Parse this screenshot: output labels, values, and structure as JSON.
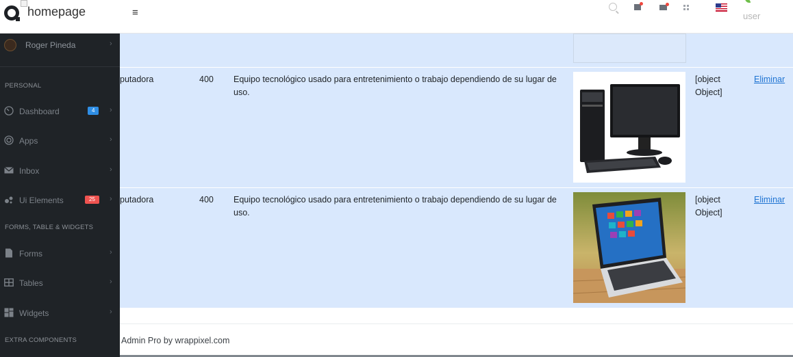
{
  "header": {
    "brand_alt": "homepage",
    "menu_icon": "≡",
    "icons": [
      "search-icon",
      "message-icon",
      "mail-icon",
      "apps-grid-icon",
      "flag-us-icon"
    ],
    "user_alt": "user"
  },
  "sidebar": {
    "profile_name": "Roger Pineda",
    "sections": {
      "personal": "PERSONAL",
      "forms": "FORMS, TABLE & WIDGETS",
      "extra": "EXTRA COMPONENTS"
    },
    "items": [
      {
        "label": "Dashboard",
        "icon": "dashboard-icon",
        "badge": "4"
      },
      {
        "label": "Apps",
        "icon": "target-icon"
      },
      {
        "label": "Inbox",
        "icon": "envelope-icon"
      },
      {
        "label": "Ui Elements",
        "icon": "bubbles-icon",
        "badge": "25"
      },
      {
        "label": "Forms",
        "icon": "file-icon"
      },
      {
        "label": "Tables",
        "icon": "table-icon"
      },
      {
        "label": "Widgets",
        "icon": "widgets-icon"
      }
    ],
    "chevron": "›"
  },
  "table": {
    "rows": [
      {
        "name": "putadora",
        "price": "400",
        "description": "Equipo tecnológico usado para entretenimiento o trabajo dependiendo de su lugar de uso.",
        "image": "desktop-computer-image",
        "category": "[object Object]",
        "action": "Eliminar"
      },
      {
        "name": "putadora",
        "price": "400",
        "description": "Equipo tecnológico usado para entretenimiento o trabajo dependiendo de su lugar de uso.",
        "image": "laptop-image",
        "category": "[object Object]",
        "action": "Eliminar"
      }
    ]
  },
  "footer": {
    "text": "Admin Pro by wrappixel.com"
  },
  "colors": {
    "sidebar_bg": "#1f2327",
    "row_highlight": "#d9e8fd",
    "link": "#1e73d2",
    "badge_blue": "#2f8ee5",
    "badge_red": "#ef5350"
  }
}
